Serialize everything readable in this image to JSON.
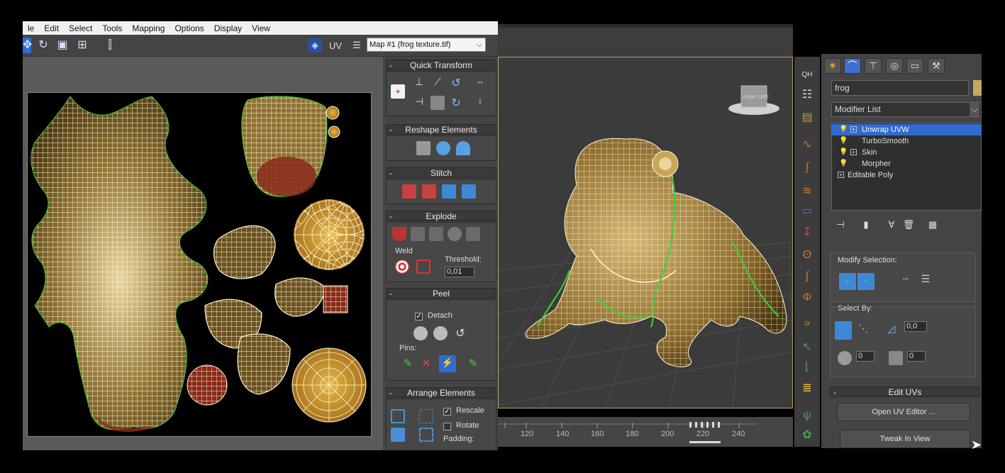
{
  "uv_editor": {
    "menu": [
      "le",
      "Edit",
      "Select",
      "Tools",
      "Mapping",
      "Options",
      "Display",
      "View"
    ],
    "uv_label": "UV",
    "map_select": "Map #1 (frog texture.tif)",
    "rollouts": {
      "quick_transform": "Quick Transform",
      "reshape": "Reshape Elements",
      "stitch": "Stitch",
      "explode": "Explode",
      "weld": "Weld",
      "threshold_label": "Threshold:",
      "threshold_value": "0,01",
      "peel": "Peel",
      "detach": "Detach",
      "pins": "Pins:",
      "arrange": "Arrange Elements",
      "rescale": "Rescale",
      "rotate": "Rotate",
      "padding": "Padding:",
      "minus": "-"
    }
  },
  "viewport": {
    "viewcube_label": "FRONT LEFT",
    "timeline_ticks": [
      "120",
      "140",
      "160",
      "180",
      "200",
      "220",
      "240"
    ]
  },
  "command_panel": {
    "object_name": "frog",
    "modifier_list": "Modifier List",
    "stack": [
      {
        "label": "Unwrap UVW",
        "selected": true,
        "expandable": true,
        "bulb": true
      },
      {
        "label": "TurboSmooth",
        "selected": false,
        "expandable": false,
        "bulb": true
      },
      {
        "label": "Skin",
        "selected": false,
        "expandable": true,
        "bulb": true
      },
      {
        "label": "Morpher",
        "selected": false,
        "expandable": false,
        "bulb": true
      },
      {
        "label": "Editable Poly",
        "selected": false,
        "expandable": true,
        "bulb": false
      }
    ],
    "modify_selection": "Modify Selection:",
    "select_by": "Select By:",
    "angle_value": "0,0",
    "spin_a": "0",
    "spin_b": "0",
    "edit_uvs": "Edit UVs",
    "open_uv_editor": "Open UV Editor ...",
    "tweak_in_view": "Tweak In View",
    "minus": "-"
  },
  "colors": {
    "uv_mesh": "#fff6d8",
    "uv_fill_dark": "#4d3a12",
    "uv_fill_light": "#e8d6a0",
    "uv_seam": "#39d239",
    "selection": "#2f6bd1",
    "viewport_frame": "#b8a35a"
  },
  "icons": [
    "create-icon",
    "modify-icon",
    "hierarchy-icon",
    "motion-icon",
    "display-icon",
    "utilities-icon"
  ]
}
